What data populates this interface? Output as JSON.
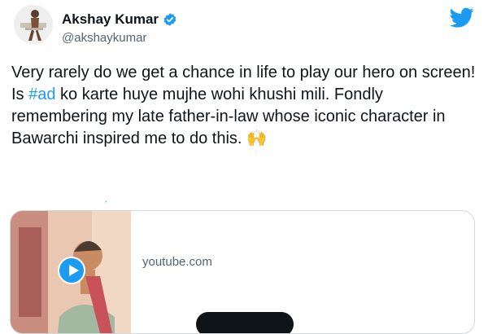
{
  "author": {
    "name": "Akshay Kumar",
    "handle": "@akshaykumar"
  },
  "icons": {
    "verified": "verified-badge-icon",
    "platform": "twitter-bird-icon",
    "play": "play-icon"
  },
  "colors": {
    "accent": "#1d9bf0",
    "text": "#0f1419",
    "muted": "#536471",
    "border": "#cfd9de"
  },
  "tweet": {
    "text_before_hashtag": "Very rarely do we get a chance in life to play our hero on screen! Is ",
    "hashtag": "#ad",
    "text_after_hashtag": " ko karte huye mujhe wohi khushi mili. Fondly remembering my late father-in-law whose iconic character in Bawarchi inspired me to do this. 🙌"
  },
  "card": {
    "domain": "youtube.com"
  }
}
